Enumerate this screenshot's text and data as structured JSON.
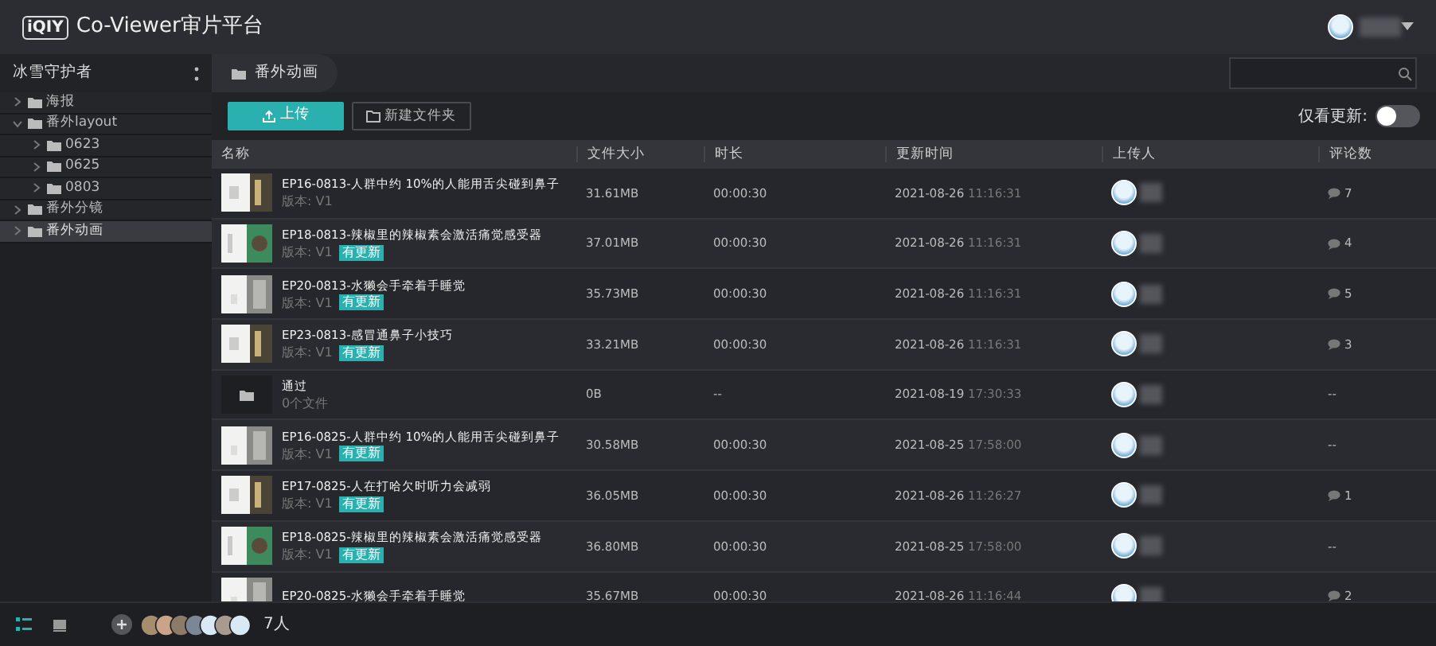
{
  "header": {
    "logo": "iQIY",
    "title": "Co-Viewer审片平台"
  },
  "project": {
    "name": "冰雪守护者",
    "breadcrumb": "番外动画"
  },
  "tree": [
    {
      "label": "海报",
      "expanded": false,
      "selected": false
    },
    {
      "label": "番外layout",
      "expanded": true,
      "selected": false,
      "children": [
        {
          "label": "0623",
          "expanded": false,
          "selected": false
        },
        {
          "label": "0625",
          "expanded": false,
          "selected": false
        },
        {
          "label": "0803",
          "expanded": false,
          "selected": false
        }
      ]
    },
    {
      "label": "番外分镜",
      "expanded": false,
      "selected": false
    },
    {
      "label": "番外动画",
      "expanded": false,
      "selected": true
    }
  ],
  "toolbar": {
    "upload": "上传",
    "new_folder": "新建文件夹",
    "filter_label": "仅看更新:",
    "filter_on": false
  },
  "table": {
    "columns": [
      "名称",
      "文件大小",
      "时长",
      "更新时间",
      "上传人",
      "评论数"
    ],
    "rows": [
      {
        "kind": "video",
        "title": "EP16-0813-人群中约 10%的人能用舌尖碰到鼻子",
        "subtitle": "版本: V1",
        "size": "31.61MB",
        "duration": "00:00:30",
        "date": "2021-08-26",
        "time": "11:16:31",
        "comment_icon": true,
        "comments": "7"
      },
      {
        "kind": "video",
        "title": "EP18-0813-辣椒里的辣椒素会激活痛觉感受器",
        "subtitle": "版本: V1",
        "badge": "有更新",
        "size": "37.01MB",
        "duration": "00:00:30",
        "date": "2021-08-26",
        "time": "11:16:31",
        "comment_icon": true,
        "comments": "4"
      },
      {
        "kind": "video",
        "title": "EP20-0813-水獭会手牵着手睡觉",
        "subtitle": "版本: V1",
        "badge": "有更新",
        "size": "35.73MB",
        "duration": "00:00:30",
        "date": "2021-08-26",
        "time": "11:16:31",
        "comment_icon": true,
        "comments": "5"
      },
      {
        "kind": "video",
        "title": "EP23-0813-感冒通鼻子小技巧",
        "subtitle": "版本: V1",
        "badge": "有更新",
        "size": "33.21MB",
        "duration": "00:00:30",
        "date": "2021-08-26",
        "time": "11:16:31",
        "comment_icon": true,
        "comments": "3"
      },
      {
        "kind": "folder",
        "title": "通过",
        "subtitle": "0个文件",
        "size": "0B",
        "duration": "--",
        "date": "2021-08-19",
        "time": "17:30:33",
        "comment_icon": false,
        "comments": "--"
      },
      {
        "kind": "video",
        "title": "EP16-0825-人群中约 10%的人能用舌尖碰到鼻子",
        "subtitle": "版本: V1",
        "badge": "有更新",
        "size": "30.58MB",
        "duration": "00:00:30",
        "date": "2021-08-25",
        "time": "17:58:00",
        "comment_icon": false,
        "comments": "--"
      },
      {
        "kind": "video",
        "title": "EP17-0825-人在打哈欠时听力会减弱",
        "subtitle": "版本: V1",
        "badge": "有更新",
        "size": "36.05MB",
        "duration": "00:00:30",
        "date": "2021-08-26",
        "time": "11:26:27",
        "comment_icon": true,
        "comments": "1"
      },
      {
        "kind": "video",
        "title": "EP18-0825-辣椒里的辣椒素会激活痛觉感受器",
        "subtitle": "版本: V1",
        "badge": "有更新",
        "size": "36.80MB",
        "duration": "00:00:30",
        "date": "2021-08-25",
        "time": "17:58:00",
        "comment_icon": false,
        "comments": "--"
      },
      {
        "kind": "video",
        "title": "EP20-0825-水獭会手牵着手睡觉",
        "size": "35.67MB",
        "duration": "00:00:30",
        "date": "2021-08-26",
        "time": "11:16:44",
        "comment_icon": true,
        "comments": "2"
      }
    ]
  },
  "footer": {
    "view_modes": [
      {
        "selected": true
      },
      {
        "selected": false
      }
    ],
    "members": "7人"
  }
}
